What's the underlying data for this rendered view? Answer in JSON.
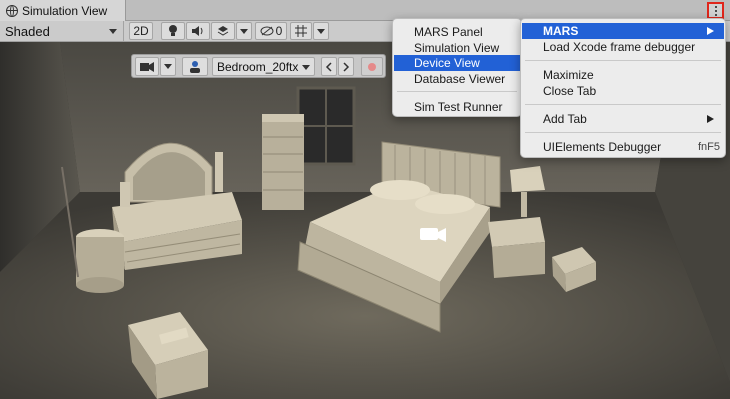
{
  "window": {
    "tab_title": "Simulation View",
    "more_icon": "kebab-menu-icon"
  },
  "toolbar": {
    "shading_mode": "Shaded",
    "mode_2d_label": "2D",
    "hidden_count": "0",
    "icons": [
      "lightbulb-icon",
      "audio-icon",
      "effects-icon",
      "visibility-icon",
      "grid-icon"
    ]
  },
  "scene_toolbar": {
    "environment": "Bedroom_20ftx",
    "icons": [
      "camera-icon",
      "device-icon",
      "prev-icon",
      "next-icon",
      "record-icon"
    ]
  },
  "context_menu": {
    "items": [
      {
        "label": "MARS",
        "selected": true,
        "submenu": true
      },
      {
        "label": "Load Xcode frame debugger"
      },
      {
        "label": "Maximize"
      },
      {
        "label": "Close Tab"
      },
      {
        "label": "Add Tab",
        "submenu": true
      },
      {
        "label": "UIElements Debugger",
        "shortcut": "fnF5"
      }
    ]
  },
  "mars_submenu": {
    "items": [
      {
        "label": "MARS Panel"
      },
      {
        "label": "Simulation View"
      },
      {
        "label": "Device View",
        "selected": true
      },
      {
        "label": "Database Viewer"
      },
      {
        "label": "Sim Test Runner"
      }
    ]
  },
  "colors": {
    "selection": "#2261d6",
    "highlight_border": "#e0261b",
    "menu_bg": "#ececec"
  }
}
